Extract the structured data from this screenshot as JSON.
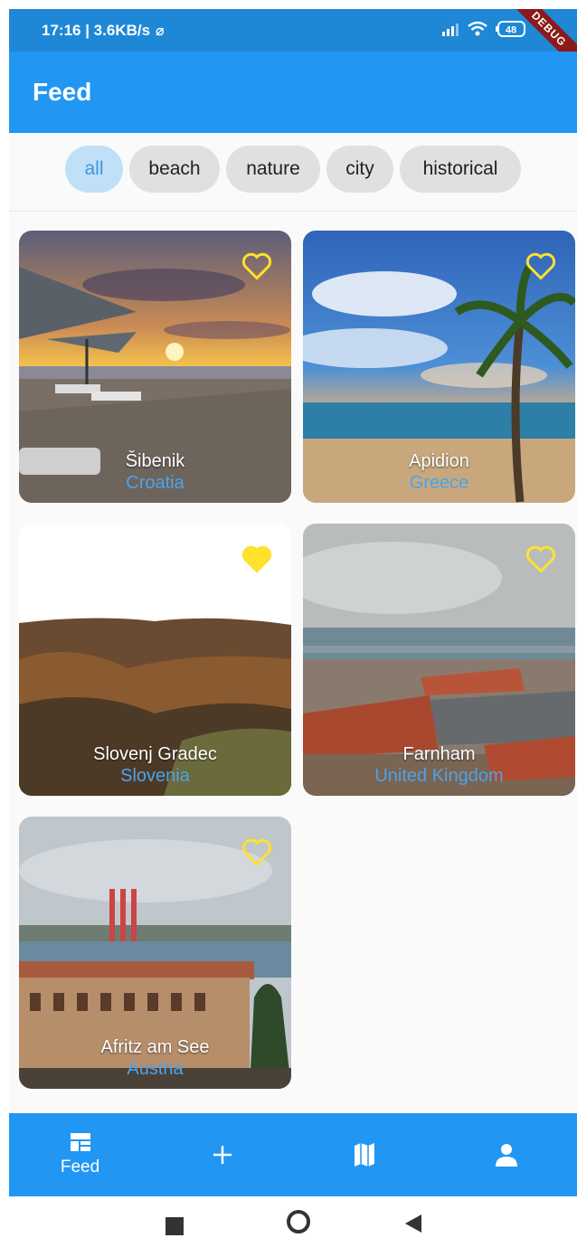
{
  "status_bar": {
    "time_speed": "17:16 | 3.6KB/s",
    "battery": "48",
    "debug_label": "DEBUG"
  },
  "app_bar": {
    "title": "Feed"
  },
  "filters": {
    "chips": [
      "all",
      "beach",
      "nature",
      "city",
      "historical"
    ],
    "selected": "all"
  },
  "cards": [
    {
      "city": "Šibenik",
      "country": "Croatia",
      "favorite": false
    },
    {
      "city": "Apidion",
      "country": "Greece",
      "favorite": false
    },
    {
      "city": "Slovenj Gradec",
      "country": "Slovenia",
      "favorite": true
    },
    {
      "city": "Farnham",
      "country": "United Kingdom",
      "favorite": false
    },
    {
      "city": "Afritz am See",
      "country": "Austria",
      "favorite": false
    }
  ],
  "bottom_nav": {
    "items": [
      {
        "icon": "dashboard-icon",
        "label": "Feed"
      },
      {
        "icon": "add-icon",
        "label": ""
      },
      {
        "icon": "map-icon",
        "label": ""
      },
      {
        "icon": "person-icon",
        "label": ""
      }
    ]
  },
  "colors": {
    "primary": "#2196f3",
    "status_bar": "#1e88d6",
    "heart": "#ffe12e",
    "country": "#4aa3ec",
    "chip_selected": "#bfe0f7"
  }
}
